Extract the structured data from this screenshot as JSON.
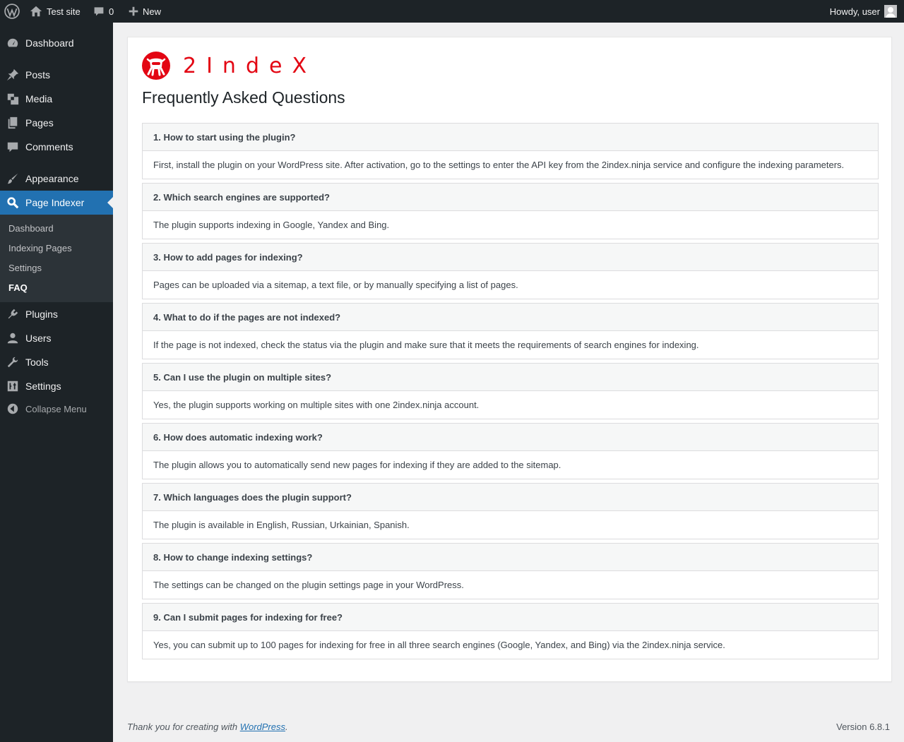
{
  "adminbar": {
    "site_name": "Test site",
    "comments_count": "0",
    "new_label": "New",
    "howdy": "Howdy, user"
  },
  "sidebar": {
    "items": [
      {
        "label": "Dashboard",
        "icon": "dashboard-icon"
      },
      {
        "label": "Posts",
        "icon": "pin-icon"
      },
      {
        "label": "Media",
        "icon": "media-icon"
      },
      {
        "label": "Pages",
        "icon": "pages-icon"
      },
      {
        "label": "Comments",
        "icon": "comment-icon"
      },
      {
        "label": "Appearance",
        "icon": "paintbrush-icon"
      },
      {
        "label": "Page Indexer",
        "icon": "search-icon"
      },
      {
        "label": "Plugins",
        "icon": "plugin-icon"
      },
      {
        "label": "Users",
        "icon": "user-icon"
      },
      {
        "label": "Tools",
        "icon": "wrench-icon"
      },
      {
        "label": "Settings",
        "icon": "settings-icon"
      }
    ],
    "submenu": [
      "Dashboard",
      "Indexing Pages",
      "Settings",
      "FAQ"
    ],
    "collapse": "Collapse Menu"
  },
  "brand": {
    "logo_text": "2IndeX",
    "accent": "#e30613"
  },
  "page": {
    "title": "Frequently Asked Questions",
    "faqs": [
      {
        "q": "1. How to start using the plugin?",
        "a": "First, install the plugin on your WordPress site. After activation, go to the settings to enter the API key from the 2index.ninja service and configure the indexing parameters."
      },
      {
        "q": "2. Which search engines are supported?",
        "a": "The plugin supports indexing in Google, Yandex and Bing."
      },
      {
        "q": "3. How to add pages for indexing?",
        "a": "Pages can be uploaded via a sitemap, a text file, or by manually specifying a list of pages."
      },
      {
        "q": "4. What to do if the pages are not indexed?",
        "a": "If the page is not indexed, check the status via the plugin and make sure that it meets the requirements of search engines for indexing."
      },
      {
        "q": "5. Can I use the plugin on multiple sites?",
        "a": "Yes, the plugin supports working on multiple sites with one 2index.ninja account."
      },
      {
        "q": "6. How does automatic indexing work?",
        "a": "The plugin allows you to automatically send new pages for indexing if they are added to the sitemap."
      },
      {
        "q": "7. Which languages does the plugin support?",
        "a": "The plugin is available in English, Russian, Urkainian, Spanish."
      },
      {
        "q": "8. How to change indexing settings?",
        "a": "The settings can be changed on the plugin settings page in your WordPress."
      },
      {
        "q": "9. Can I submit pages for indexing for free?",
        "a": "Yes, you can submit up to 100 pages for indexing for free in all three search engines (Google, Yandex, and Bing) via the 2index.ninja service."
      }
    ]
  },
  "footer": {
    "thanks_prefix": "Thank you for creating with ",
    "wordpress_link": "WordPress",
    "thanks_suffix": ".",
    "version": "Version 6.8.1"
  }
}
